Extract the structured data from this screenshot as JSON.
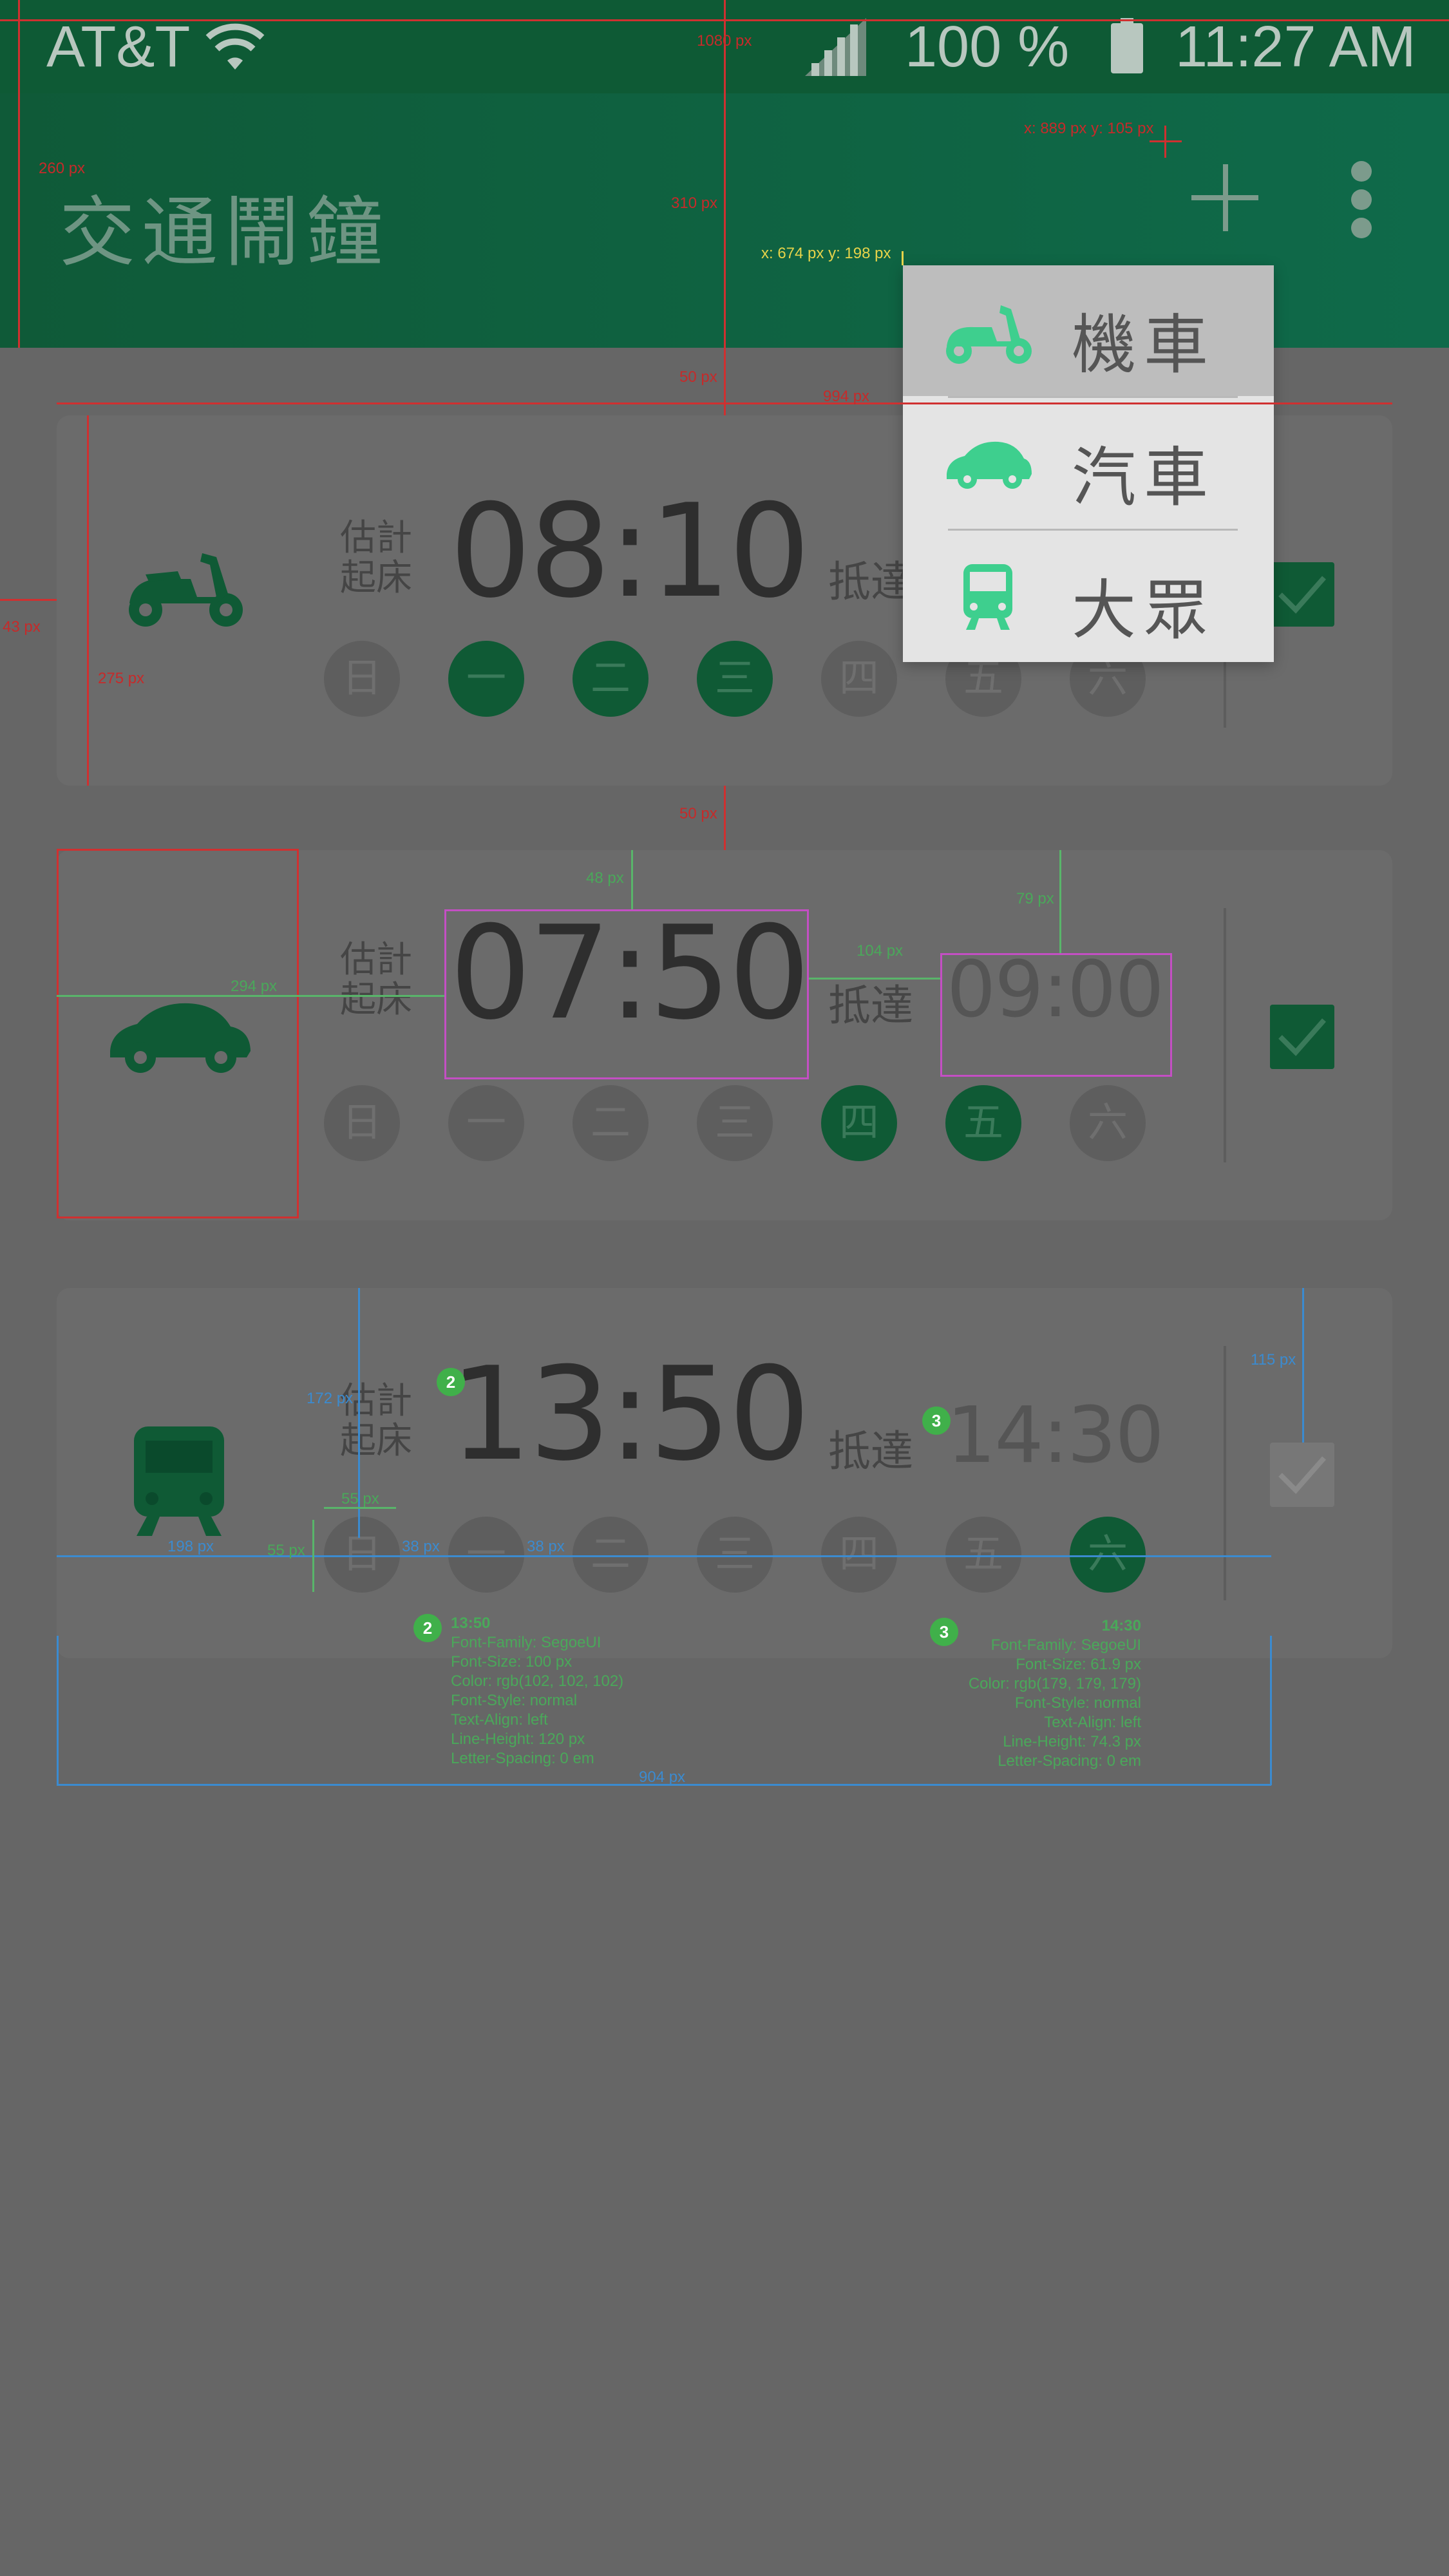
{
  "status_bar": {
    "carrier": "AT&T",
    "battery_pct": "100 %",
    "time": "11:27 AM"
  },
  "app_bar": {
    "title": "交通鬧鐘"
  },
  "alarm_labels": {
    "wake": "估計起床",
    "arrive": "抵達"
  },
  "days": [
    "日",
    "一",
    "二",
    "三",
    "四",
    "五",
    "六"
  ],
  "alarms": [
    {
      "vehicle_icon": "scooter-icon",
      "wake_time": "08:10",
      "arrive_time": "",
      "days_on": [
        false,
        true,
        true,
        true,
        false,
        false,
        false
      ],
      "enabled": true
    },
    {
      "vehicle_icon": "car-icon",
      "wake_time": "07:50",
      "arrive_time": "09:00",
      "days_on": [
        false,
        false,
        false,
        false,
        true,
        true,
        false
      ],
      "enabled": true
    },
    {
      "vehicle_icon": "bus-icon",
      "wake_time": "13:50",
      "arrive_time": "14:30",
      "days_on": [
        false,
        false,
        false,
        false,
        false,
        false,
        true
      ],
      "enabled": false
    }
  ],
  "popup_menu": {
    "items": [
      {
        "label": "機車",
        "icon": "scooter-icon"
      },
      {
        "label": "汽車",
        "icon": "car-icon"
      },
      {
        "label": "大眾",
        "icon": "bus-icon"
      }
    ]
  },
  "colors": {
    "primary": "#0f5a35",
    "accent_icon": "#3ecf8e",
    "card": "#6b6b6b",
    "overlay": "#666666"
  },
  "annotations": {
    "labels": [
      "1080 px",
      "260 px",
      "310 px",
      "x: 889 px y: 105 px",
      "x: 674 px y: 198 px",
      "50 px",
      "994 px",
      "43 px",
      "275 px",
      "50 px",
      "48 px",
      "294 px",
      "104 px",
      "79 px",
      "172 px",
      "115 px",
      "55 px",
      "198 px",
      "55 px",
      "38 px",
      "38 px",
      "904 px"
    ],
    "spec_13_50": {
      "badge": "2",
      "title": "13:50",
      "lines": [
        "Font-Family: SegoeUI",
        "Font-Size: 100 px",
        "Color: rgb(102, 102, 102)",
        "Font-Style: normal",
        "Text-Align: left",
        "Line-Height: 120 px",
        "Letter-Spacing: 0 em"
      ]
    },
    "spec_14_30": {
      "badge": "3",
      "title": "14:30",
      "lines": [
        "Font-Family: SegoeUI",
        "Font-Size: 61.9 px",
        "Color: rgb(179, 179, 179)",
        "Font-Style: normal",
        "Text-Align: left",
        "Line-Height: 74.3 px",
        "Letter-Spacing: 0 em"
      ]
    }
  }
}
